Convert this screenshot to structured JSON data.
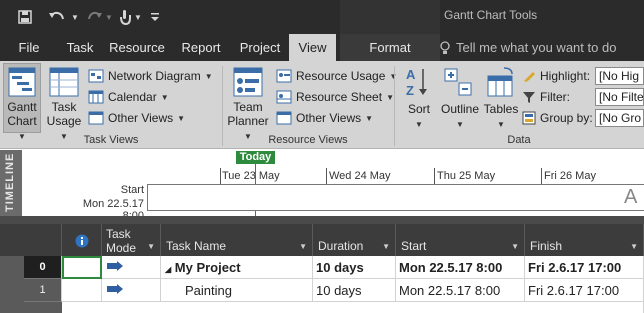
{
  "quick_access": {
    "save_icon": "save-icon",
    "undo_icon": "undo-icon",
    "redo_icon": "redo-icon",
    "touch_icon": "touch-mode-icon",
    "customize_icon": "customize-qat-icon"
  },
  "context_title": "Gantt Chart Tools",
  "tabs": [
    "File",
    "Task",
    "Resource",
    "Report",
    "Project",
    "View",
    "Format"
  ],
  "active_tab": "View",
  "tell_me": "Tell me what you want to do",
  "ribbon": {
    "task_views": {
      "label": "Task Views",
      "gantt_chart": [
        "Gantt",
        "Chart"
      ],
      "task_usage": [
        "Task",
        "Usage"
      ],
      "network_diagram": "Network Diagram",
      "calendar": "Calendar",
      "other_views": "Other Views"
    },
    "resource_views": {
      "label": "Resource Views",
      "team_planner": [
        "Team",
        "Planner"
      ],
      "resource_usage": "Resource Usage",
      "resource_sheet": "Resource Sheet",
      "other_views": "Other Views"
    },
    "data": {
      "label": "Data",
      "sort": "Sort",
      "outline": "Outline",
      "tables": "Tables",
      "highlight_label": "Highlight:",
      "highlight_value": "[No Hig",
      "filter_label": "Filter:",
      "filter_value": "[No Filte",
      "groupby_label": "Group by:",
      "groupby_value": "[No Gro"
    }
  },
  "timeline": {
    "side_label": "TIMELINE",
    "today": "Today",
    "dates": [
      "Tue 23 May",
      "Wed 24 May",
      "Thu 25 May",
      "Fri 26 May"
    ],
    "start_label": "Start",
    "start_date": "Mon 22.5.17 8:00",
    "cut_letter": "A"
  },
  "grid": {
    "headers": {
      "info_icon": "info-icon",
      "task_mode": [
        "Task",
        "Mode"
      ],
      "task_name": "Task Name",
      "duration": "Duration",
      "start": "Start",
      "finish": "Finish"
    },
    "rows": [
      {
        "id": "0",
        "mode_icon": "auto-scheduled-icon",
        "name": "My Project",
        "duration": "10 days",
        "start": "Mon 22.5.17 8:00",
        "finish": "Fri 2.6.17 17:00",
        "summary": true,
        "collapse_icon": "collapse-triangle-icon"
      },
      {
        "id": "1",
        "mode_icon": "auto-scheduled-icon",
        "name": "Painting",
        "duration": "10 days",
        "start": "Mon 22.5.17 8:00",
        "finish": "Fri 2.6.17 17:00",
        "summary": false
      }
    ]
  },
  "colors": {
    "titlebar": "#2b2b2b",
    "ribbon": "#d4d4d4",
    "today_green": "#2e8b3e",
    "header_dark": "#3c3c3c"
  }
}
